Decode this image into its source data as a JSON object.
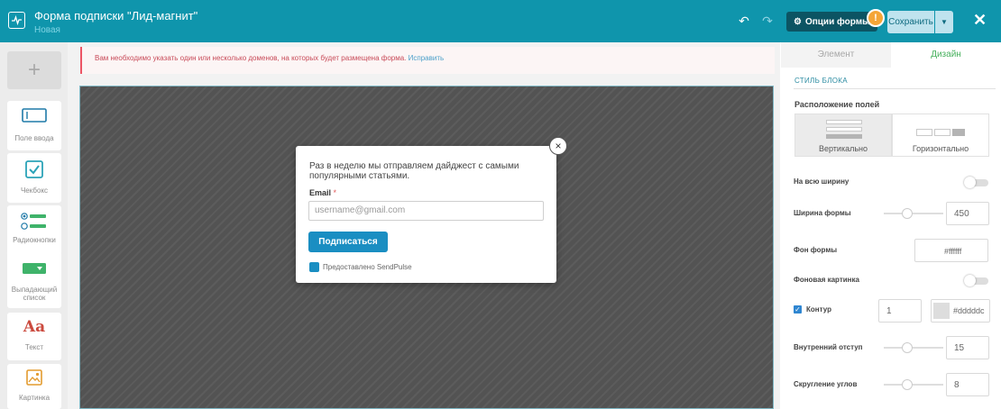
{
  "header": {
    "title": "Форма подписки \"Лид-магнит\"",
    "status": "Новая",
    "options_label": "Опции формы",
    "warning_symbol": "!",
    "save_label": "Сохранить",
    "colors": {
      "bar": "#0f95ac",
      "save_bg": "#bfe3ee"
    }
  },
  "sidebar": {
    "add_symbol": "+",
    "items": [
      {
        "label": "Поле ввода",
        "icon": "input-field-icon"
      },
      {
        "label": "Чекбокс",
        "icon": "checkbox-icon"
      },
      {
        "label": "Радиокнопки",
        "icon": "radio-icon"
      },
      {
        "label": "Выпадающий список",
        "icon": "dropdown-icon"
      },
      {
        "label": "Текст",
        "icon": "text-icon",
        "glyph": "Aa"
      },
      {
        "label": "Картинка",
        "icon": "image-icon"
      }
    ]
  },
  "notice": {
    "text": "Вам необходимо указать один или несколько доменов, на которых будет размещена форма.",
    "link": "Исправить"
  },
  "form": {
    "description": "Раз в неделю мы отправляем дайджест с самыми популярными статьями.",
    "email_label": "Email",
    "required_mark": "*",
    "email_placeholder": "username@gmail.com",
    "submit_label": "Подписаться",
    "powered_by": "Предоставлено SendPulse",
    "close_symbol": "×"
  },
  "panel": {
    "tabs": [
      {
        "label": "Элемент",
        "active": false
      },
      {
        "label": "Дизайн",
        "active": true
      }
    ],
    "section_title": "СТИЛЬ БЛОКА",
    "layout_label": "Расположение полей",
    "layout_options": [
      {
        "label": "Вертикально",
        "selected": true
      },
      {
        "label": "Горизонтально",
        "selected": false
      }
    ],
    "full_width": {
      "label": "На всю ширину",
      "on": false
    },
    "form_width": {
      "label": "Ширина формы",
      "value": "450"
    },
    "form_bg": {
      "label": "Фон формы",
      "value": "#ffffff"
    },
    "bg_image": {
      "label": "Фоновая картинка",
      "on": false
    },
    "contour": {
      "label": "Контур",
      "checked": true,
      "width": "1",
      "color": "#dddddc"
    },
    "padding": {
      "label": "Внутренний отступ",
      "value": "15"
    },
    "radius": {
      "label": "Скругление углов",
      "value": "8"
    }
  }
}
